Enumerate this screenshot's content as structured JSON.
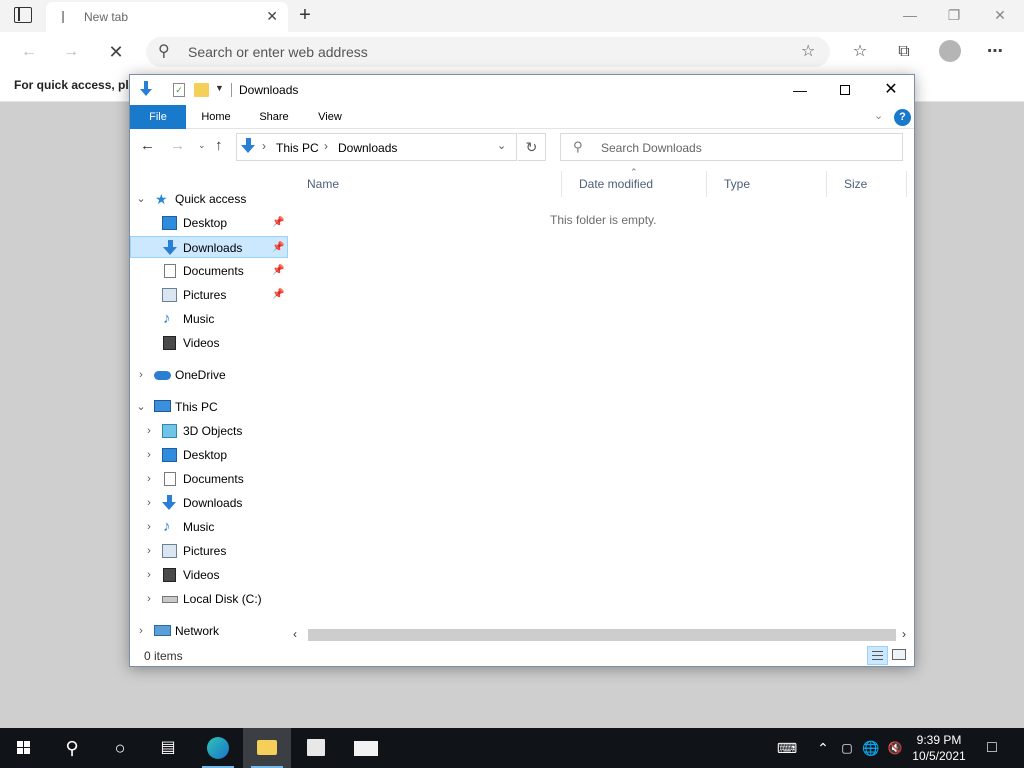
{
  "browser": {
    "tab_title": "New tab",
    "address_placeholder": "Search or enter web address",
    "favbar_text": "For quick access, plac"
  },
  "explorer": {
    "window_title": "Downloads",
    "ribbon_tabs": [
      "File",
      "Home",
      "Share",
      "View"
    ],
    "breadcrumb": [
      "This PC",
      "Downloads"
    ],
    "search_placeholder": "Search Downloads",
    "columns": [
      "Name",
      "Date modified",
      "Type",
      "Size"
    ],
    "empty_message": "This folder is empty.",
    "status": "0 items",
    "nav": {
      "quick_access": "Quick access",
      "quick_items": [
        "Desktop",
        "Downloads",
        "Documents",
        "Pictures",
        "Music",
        "Videos"
      ],
      "onedrive": "OneDrive",
      "this_pc": "This PC",
      "pc_items": [
        "3D Objects",
        "Desktop",
        "Documents",
        "Downloads",
        "Music",
        "Pictures",
        "Videos",
        "Local Disk (C:)"
      ],
      "network": "Network"
    }
  },
  "taskbar": {
    "time": "9:39 PM",
    "date": "10/5/2021"
  },
  "colors": {
    "accent": "#1979ca",
    "selection": "#cce8ff",
    "taskbar": "#101418"
  }
}
